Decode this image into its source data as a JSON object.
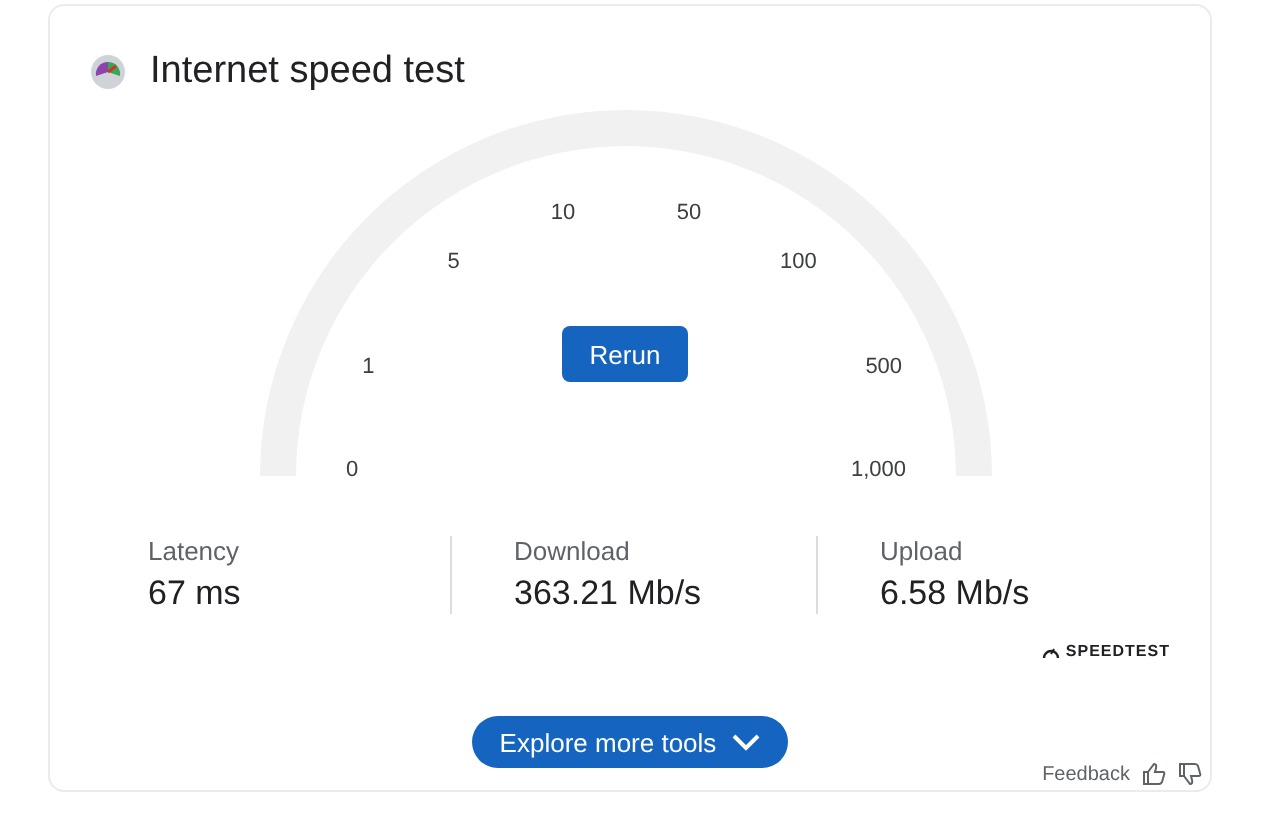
{
  "title": "Internet speed test",
  "gauge": {
    "ticks": [
      "0",
      "1",
      "5",
      "10",
      "50",
      "100",
      "500",
      "1,000"
    ]
  },
  "rerun_button": "Rerun",
  "stats": [
    {
      "label": "Latency",
      "value": "67 ms"
    },
    {
      "label": "Download",
      "value": "363.21 Mb/s"
    },
    {
      "label": "Upload",
      "value": "6.58 Mb/s"
    }
  ],
  "brand": "SPEEDTEST",
  "explore_button": "Explore more tools",
  "feedback": "Feedback"
}
